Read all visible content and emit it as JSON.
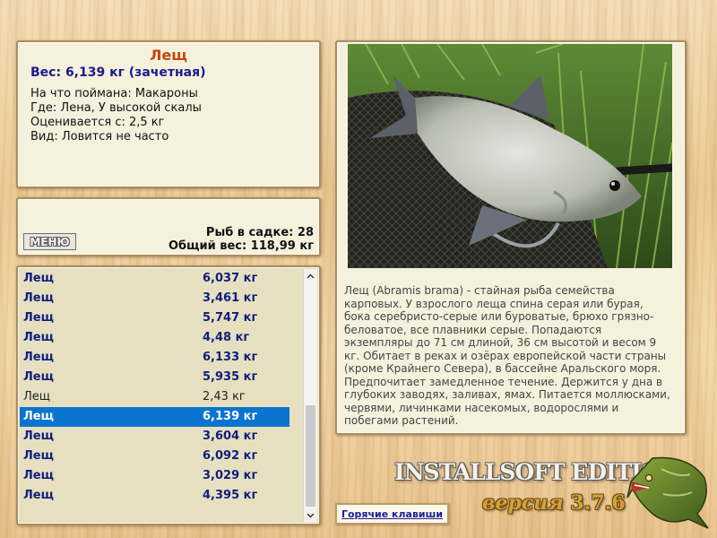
{
  "info": {
    "fish_name": "Лещ",
    "weight_line": "Вес: 6,139 кг (зачетная)",
    "caught_with": "На что поймана: Макароны",
    "where": "Где: Лена, У высокой скалы",
    "valued_from": "Оценивается с: 2,5 кг",
    "kind": "Вид: Ловится не часто"
  },
  "cage": {
    "menu_label": "МЕНЮ",
    "fish_count": "Рыб в садке: 28",
    "total_weight": "Общий вес: 118,99 кг"
  },
  "list": {
    "rows": [
      {
        "name": "Лещ",
        "weight": "6,037 кг",
        "style": "bold"
      },
      {
        "name": "Лещ",
        "weight": "3,461 кг",
        "style": "bold"
      },
      {
        "name": "Лещ",
        "weight": "5,747 кг",
        "style": "bold"
      },
      {
        "name": "Лещ",
        "weight": "4,48 кг",
        "style": "bold"
      },
      {
        "name": "Лещ",
        "weight": "6,133 кг",
        "style": "bold"
      },
      {
        "name": "Лещ",
        "weight": "5,935 кг",
        "style": "bold"
      },
      {
        "name": "Лещ",
        "weight": "2,43 кг",
        "style": "normal"
      },
      {
        "name": "Лещ",
        "weight": "6,139 кг",
        "style": "selected"
      },
      {
        "name": "Лещ",
        "weight": "3,604 кг",
        "style": "bold"
      },
      {
        "name": "Лещ",
        "weight": "6,092 кг",
        "style": "bold"
      },
      {
        "name": "Лещ",
        "weight": "3,029 кг",
        "style": "bold"
      },
      {
        "name": "Лещ",
        "weight": "4,395 кг",
        "style": "bold"
      }
    ],
    "scroll_up_icon": "chevron-up-icon",
    "scroll_down_icon": "chevron-down-icon"
  },
  "photo": {
    "description": "Лещ (Abramis brama) - стайная рыба семейства карповых. У взрослого леща спина серая или бурая, бока серебристо-серые или буроватые, брюхо грязно-беловатое, все плавники серые. Попадаются экземпляры до 71 см длиной, 36 см высотой и весом 9 кг. Обитает в реках и озёрах европейской части страны (кроме Крайнего Севера), в бассейне Аральского моря. Предпочитает замедленное течение. Держится у дна в глубоких заводях, заливах, ямах. Питается моллюсками, червями, личинками насекомых, водорослями и побегами растений."
  },
  "footer": {
    "hotkeys_label": "Горячие клавиши",
    "brand": "INSTALLSOFT EDITION",
    "version_word": "версия",
    "version_number": "3.7.6"
  },
  "colors": {
    "selected_row": "#0a74d0",
    "fish_name": "#c4470f",
    "weight_text": "#1a1a8c",
    "list_text": "#101e7e"
  }
}
